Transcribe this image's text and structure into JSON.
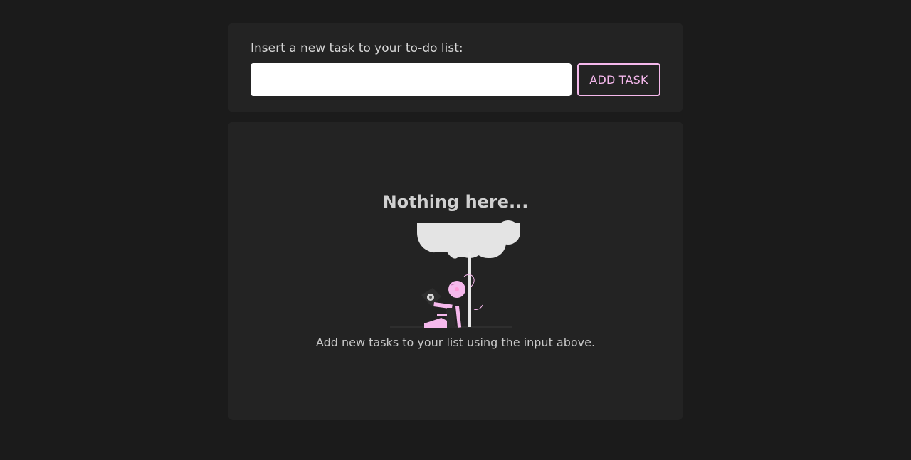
{
  "task_form": {
    "prompt": "Insert a new task to your to-do list:",
    "input_value": "",
    "input_placeholder": "",
    "add_button_label": "ADD TASK"
  },
  "empty_state": {
    "title": "Nothing here...",
    "hint": "Add new tasks to your list using the input above.",
    "illustration_icon": "person-under-umbrella-illustration"
  },
  "colors": {
    "background": "#1b1b1b",
    "card": "#232323",
    "accent": "#f5b8ec",
    "text": "#d6d6d6"
  }
}
